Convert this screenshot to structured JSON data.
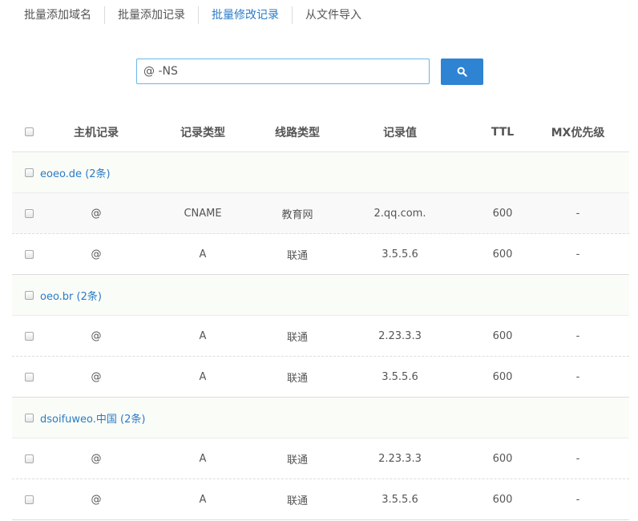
{
  "tabs": [
    {
      "label": "批量添加域名"
    },
    {
      "label": "批量添加记录"
    },
    {
      "label": "批量修改记录"
    },
    {
      "label": "从文件导入"
    }
  ],
  "search": {
    "value": "@ -NS",
    "button_icon": "search-icon"
  },
  "colors": {
    "accent": "#2f83d3",
    "link": "#2a7bc8",
    "input_border": "#68b6ea"
  },
  "columns": {
    "host": "主机记录",
    "type": "记录类型",
    "line": "线路类型",
    "value": "记录值",
    "ttl": "TTL",
    "mx": "MX优先级"
  },
  "groups": [
    {
      "label": "eoeo.de (2条)",
      "records": [
        {
          "host": "@",
          "type": "CNAME",
          "line": "教育网",
          "value": "2.qq.com.",
          "ttl": "600",
          "mx": "-"
        },
        {
          "host": "@",
          "type": "A",
          "line": "联通",
          "value": "3.5.5.6",
          "ttl": "600",
          "mx": "-"
        }
      ]
    },
    {
      "label": "oeo.br (2条)",
      "records": [
        {
          "host": "@",
          "type": "A",
          "line": "联通",
          "value": "2.23.3.3",
          "ttl": "600",
          "mx": "-"
        },
        {
          "host": "@",
          "type": "A",
          "line": "联通",
          "value": "3.5.5.6",
          "ttl": "600",
          "mx": "-"
        }
      ]
    },
    {
      "label": "dsoifuweo.中国 (2条)",
      "records": [
        {
          "host": "@",
          "type": "A",
          "line": "联通",
          "value": "2.23.3.3",
          "ttl": "600",
          "mx": "-"
        },
        {
          "host": "@",
          "type": "A",
          "line": "联通",
          "value": "3.5.5.6",
          "ttl": "600",
          "mx": "-"
        }
      ]
    }
  ]
}
